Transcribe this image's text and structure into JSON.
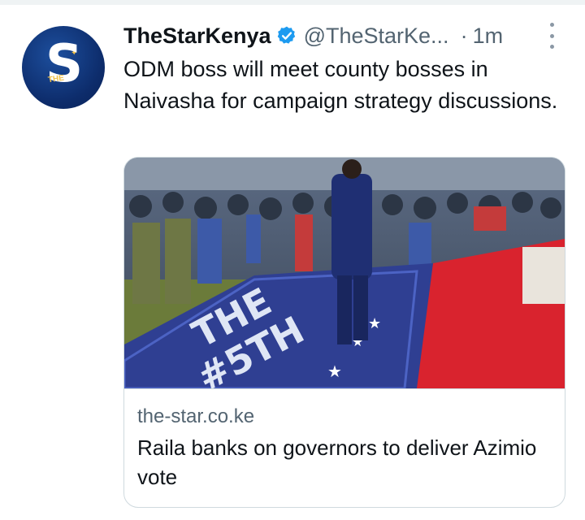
{
  "tweet": {
    "author_name": "TheStarKenya",
    "handle": "@TheStarKe...",
    "dot": "·",
    "time": "1m",
    "text": "ODM boss will meet county bosses in Naivasha for campaign strategy discussions.",
    "avatar": {
      "letter": "S",
      "small_text": "THE"
    }
  },
  "card": {
    "image": {
      "stage_text_line1": "THE",
      "stage_text_line2": "#5TH"
    },
    "domain": "the-star.co.ke",
    "headline": "Raila banks on governors to deliver Azimio vote"
  },
  "colors": {
    "accent_verified": "#1d9bf0",
    "secondary_text": "#536471",
    "border": "#cfd9de",
    "stage_blue": "#2f3f92",
    "carpet_red": "#d9232e"
  },
  "icons": [
    "verified-badge-icon",
    "more-options-icon"
  ]
}
